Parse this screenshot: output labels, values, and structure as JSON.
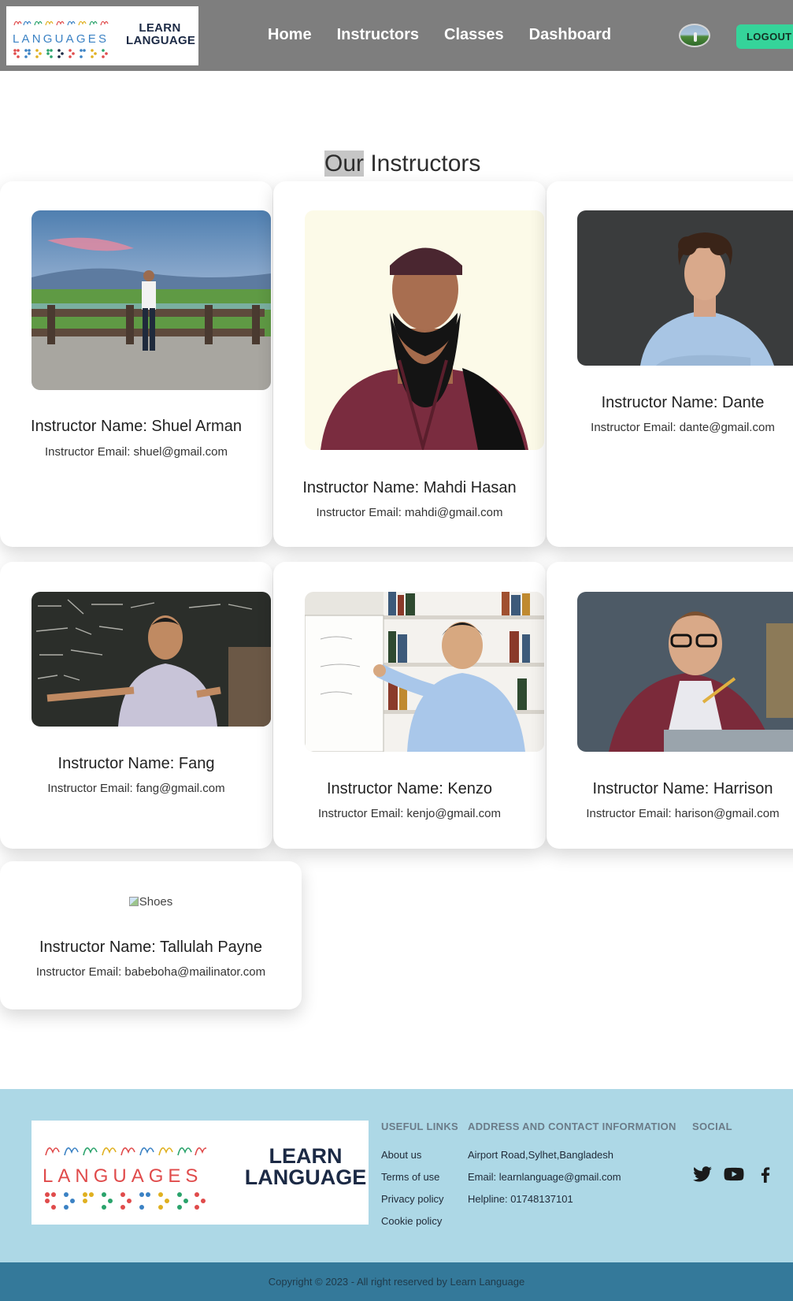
{
  "navbar": {
    "logo_text_line1": "LEARN",
    "logo_text_line2": "LANGUAGE",
    "logo_word": "LANGUAGES",
    "links": [
      "Home",
      "Instructors",
      "Classes",
      "Dashboard"
    ],
    "logout_label": "LOGOUT",
    "avatar_icon": "user-avatar"
  },
  "page": {
    "title_highlight": "Our",
    "title_rest": " Instructors"
  },
  "instructors": [
    {
      "name": "Instructor Name: Shuel Arman",
      "email": "Instructor Email: shuel@gmail.com"
    },
    {
      "name": "Instructor Name: Mahdi Hasan",
      "email": "Instructor Email: mahdi@gmail.com"
    },
    {
      "name": "Instructor Name: Dante",
      "email": "Instructor Email: dante@gmail.com"
    },
    {
      "name": "Instructor Name: Fang",
      "email": "Instructor Email: fang@gmail.com"
    },
    {
      "name": "Instructor Name: Kenzo",
      "email": "Instructor Email: kenjo@gmail.com"
    },
    {
      "name": "Instructor Name: Harrison",
      "email": "Instructor Email: harison@gmail.com"
    },
    {
      "name": "Instructor Name: Tallulah Payne",
      "email": "Instructor Email: babeboha@mailinator.com",
      "image_alt": "Shoes"
    }
  ],
  "footer": {
    "logo_text_line1": "LEARN",
    "logo_text_line2": "LANGUAGE",
    "logo_word": "LANGUAGES",
    "useful_links": {
      "heading": "USEFUL LINKS",
      "items": [
        "About us",
        "Terms of use",
        "Privacy policy",
        "Cookie policy"
      ]
    },
    "address": {
      "heading": "ADDRESS AND CONTACT INFORMATION",
      "items": [
        "Airport Road,Sylhet,Bangladesh",
        "Email: learnlanguage@gmail.com",
        "Helpline: 01748137101"
      ]
    },
    "social": {
      "heading": "SOCIAL",
      "icons": [
        "twitter-icon",
        "youtube-icon",
        "facebook-icon"
      ]
    },
    "copyright": "Copyright © 2023 - All right reserved by Learn Language"
  },
  "colors": {
    "navbar_bg": "#7e7e7e",
    "logout_bg": "#35d49a",
    "footer_bg": "#add8e6",
    "copyright_bg": "#34799a"
  }
}
